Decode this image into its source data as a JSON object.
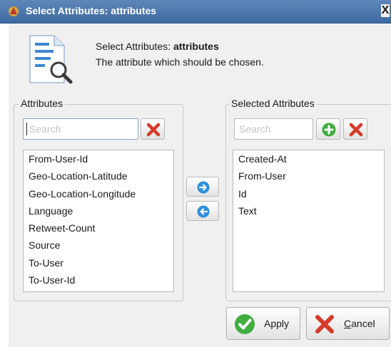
{
  "window": {
    "title": "Select Attributes: attributes",
    "close_glyph": "X"
  },
  "header": {
    "prefix": "Select Attributes:",
    "name": "attributes",
    "description": "The attribute which should be chosen."
  },
  "available": {
    "title": "Attributes",
    "search_placeholder": "Search",
    "items": [
      "From-User-Id",
      "Geo-Location-Latitude",
      "Geo-Location-Longitude",
      "Language",
      "Retweet-Count",
      "Source",
      "To-User",
      "To-User-Id"
    ]
  },
  "selected": {
    "title": "Selected Attributes",
    "search_placeholder": "Search",
    "items": [
      "Created-At",
      "From-User",
      "Id",
      "Text"
    ]
  },
  "buttons": {
    "apply": "Apply",
    "cancel_mnemonic": "C",
    "cancel_rest": "ancel"
  },
  "icons": {
    "window": "app-icon",
    "header": "document-search-icon",
    "clear": "red-x-icon",
    "add": "green-plus-icon",
    "move_right": "blue-arrow-right-icon",
    "move_left": "blue-arrow-left-icon",
    "apply": "green-check-icon",
    "cancel": "red-x-icon"
  }
}
